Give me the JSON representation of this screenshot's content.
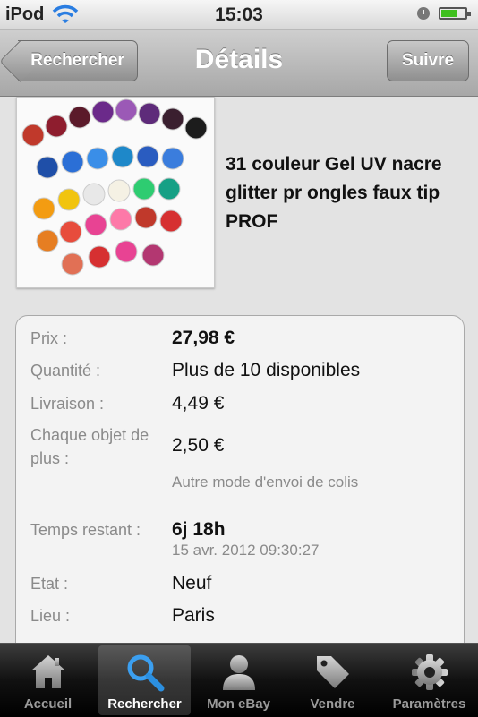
{
  "status_bar": {
    "carrier": "iPod",
    "time": "15:03"
  },
  "nav": {
    "back_label": "Rechercher",
    "title": "Détails",
    "follow_label": "Suivre"
  },
  "product": {
    "title": "31 couleur Gel UV nacre glitter pr ongles faux tip PROF"
  },
  "details": {
    "price_label": "Prix :",
    "price_value": "27,98 €",
    "quantity_label": "Quantité :",
    "quantity_value": "Plus de 10 disponibles",
    "shipping_label": "Livraison :",
    "shipping_value": "4,49 €",
    "extra_label": "Chaque objet de plus :",
    "extra_value": "2,50 €",
    "other_shipping": "Autre mode d'envoi de colis",
    "time_label": "Temps restant :",
    "time_value": "6j 18h",
    "end_date": "15 avr. 2012 09:30:27",
    "condition_label": "Etat :",
    "condition_value": "Neuf",
    "location_label": "Lieu :",
    "location_value": "Paris"
  },
  "tabbar": {
    "items": [
      {
        "label": "Accueil",
        "icon": "home-icon",
        "active": false
      },
      {
        "label": "Rechercher",
        "icon": "search-icon",
        "active": true
      },
      {
        "label": "Mon eBay",
        "icon": "person-icon",
        "active": false
      },
      {
        "label": "Vendre",
        "icon": "tag-icon",
        "active": false
      },
      {
        "label": "Paramètres",
        "icon": "gear-icon",
        "active": false
      }
    ]
  },
  "colors": {
    "tab_active_icon": "#2b8fe0",
    "battery_green": "#3fbf1f",
    "nav_gray": "#a7a7a7"
  }
}
